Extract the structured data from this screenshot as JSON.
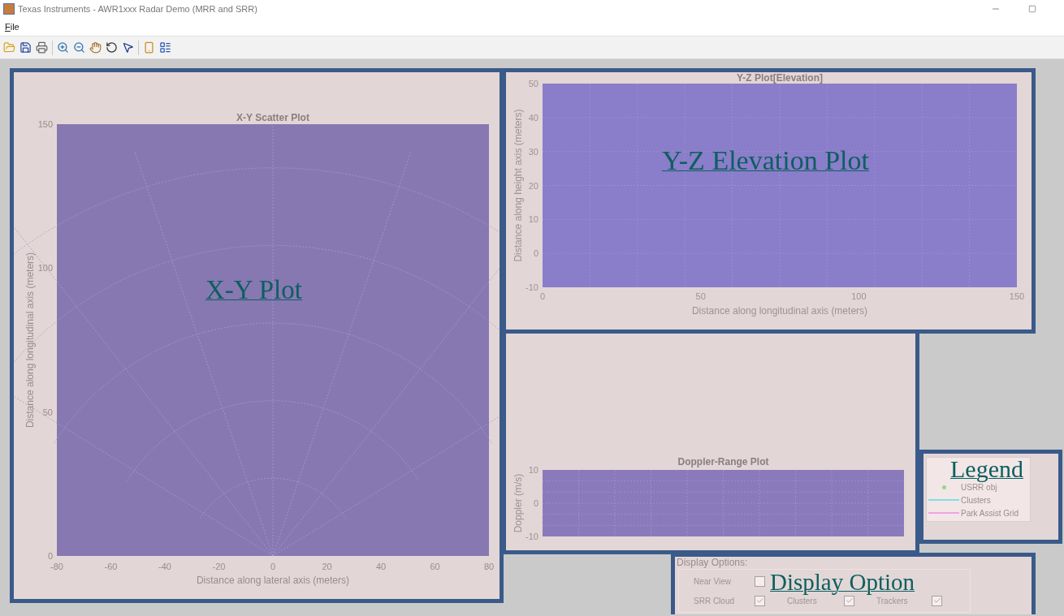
{
  "window": {
    "title": "Texas Instruments - AWR1xxx Radar Demo (MRR and SRR)"
  },
  "menu": [
    "File"
  ],
  "xy_plot": {
    "annotation": "X-Y Plot",
    "chart_data": {
      "type": "scatter",
      "title": "X-Y Scatter Plot",
      "xlabel": "Distance along lateral axis (meters)",
      "ylabel": "Distance along longitudinal axis (meters)",
      "xlim": [
        -80,
        80
      ],
      "ylim": [
        0,
        150
      ],
      "xticks": [
        -80,
        -60,
        -40,
        -20,
        0,
        20,
        40,
        60,
        80
      ],
      "yticks": [
        0,
        50,
        100,
        150
      ],
      "grid": "polar"
    }
  },
  "yz_plot": {
    "annotation": "Y-Z Elevation Plot",
    "chart_data": {
      "type": "scatter",
      "title": "Y-Z Plot[Elevation]",
      "xlabel": "Distance along longitudinal axis (meters)",
      "ylabel": "Distance along height axis (meters)",
      "xlim": [
        0,
        150
      ],
      "ylim": [
        -10,
        50
      ],
      "xticks": [
        0,
        50,
        100,
        150
      ],
      "yticks": [
        -10,
        0,
        10,
        20,
        30,
        40,
        50
      ],
      "grid": "rect"
    }
  },
  "doppler_plot": {
    "title": "Doppler-Range Plot",
    "ylabel": "Doppler (m/s)",
    "y_tick_labels": [
      "10",
      "0",
      "-10"
    ]
  },
  "legend": {
    "annotation": "Legend",
    "items": [
      {
        "label": "USRR obj",
        "kind": "marker",
        "color": "#8fd98f"
      },
      {
        "label": "Clusters",
        "kind": "line",
        "color": "#7ee0e0"
      },
      {
        "label": "Park Assist Grid",
        "kind": "line",
        "color": "#f2a2e6"
      }
    ]
  },
  "display_options": {
    "title": "Display Options:",
    "annotation": "Display Option",
    "rows": [
      [
        {
          "label": "Near View",
          "checked": false
        }
      ],
      [
        {
          "label": "SRR Cloud",
          "checked": true
        },
        {
          "label": "Clusters",
          "checked": true
        },
        {
          "label": "Trackers",
          "checked": true
        }
      ]
    ]
  }
}
